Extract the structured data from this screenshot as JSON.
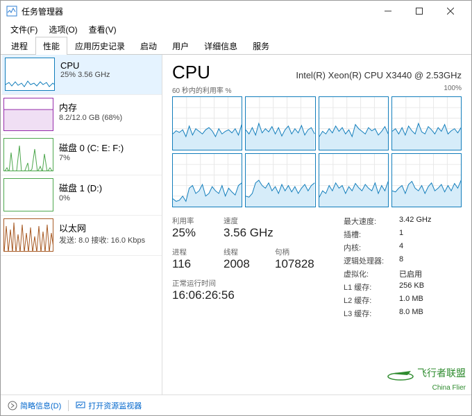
{
  "window": {
    "title": "任务管理器"
  },
  "menu": {
    "file": "文件(F)",
    "options": "选项(O)",
    "view": "查看(V)"
  },
  "tabs": {
    "processes": "进程",
    "performance": "性能",
    "app_history": "应用历史记录",
    "startup": "启动",
    "users": "用户",
    "details": "详细信息",
    "services": "服务"
  },
  "sidebar": {
    "cpu": {
      "title": "CPU",
      "sub": "25% 3.56 GHz"
    },
    "memory": {
      "title": "内存",
      "sub": "8.2/12.0 GB (68%)"
    },
    "disk0": {
      "title": "磁盘 0 (C: E: F:)",
      "sub": "7%"
    },
    "disk1": {
      "title": "磁盘 1 (D:)",
      "sub": "0%"
    },
    "net": {
      "title": "以太网",
      "sub": "发送: 8.0 接收: 16.0 Kbps"
    }
  },
  "main": {
    "title": "CPU",
    "subtitle": "Intel(R) Xeon(R) CPU X3440 @ 2.53GHz",
    "chart_left": "60 秒内的利用率 %",
    "chart_right": "100%"
  },
  "chart_data": {
    "type": "line",
    "description": "8 per-core CPU utilization sparklines over 60s, y-range 0-100%",
    "cores": [
      {
        "core": 0,
        "values": [
          30,
          36,
          33,
          38,
          25,
          45,
          28,
          40,
          35,
          30,
          38,
          42,
          36,
          25,
          40,
          30,
          35,
          38,
          32,
          40,
          28,
          48
        ]
      },
      {
        "core": 1,
        "values": [
          38,
          30,
          42,
          28,
          50,
          32,
          40,
          34,
          44,
          30,
          42,
          26,
          38,
          45,
          30,
          40,
          32,
          46,
          28,
          38,
          42,
          30
        ]
      },
      {
        "core": 2,
        "values": [
          25,
          35,
          30,
          40,
          32,
          45,
          35,
          42,
          30,
          38,
          25,
          48,
          40,
          35,
          30,
          42,
          36,
          40,
          28,
          35,
          44,
          30
        ]
      },
      {
        "core": 3,
        "values": [
          35,
          40,
          30,
          42,
          28,
          45,
          36,
          30,
          50,
          34,
          30,
          44,
          38,
          30,
          42,
          35,
          48,
          30,
          36,
          40,
          32,
          42
        ]
      },
      {
        "core": 4,
        "values": [
          15,
          10,
          12,
          20,
          10,
          35,
          40,
          25,
          30,
          42,
          20,
          25,
          38,
          30,
          25,
          40,
          20,
          35,
          28,
          22,
          40,
          45
        ]
      },
      {
        "core": 5,
        "values": [
          20,
          18,
          25,
          45,
          50,
          40,
          35,
          45,
          30,
          38,
          25,
          42,
          30,
          40,
          28,
          38,
          25,
          35,
          42,
          30,
          40,
          45
        ]
      },
      {
        "core": 6,
        "values": [
          18,
          30,
          25,
          40,
          30,
          45,
          35,
          40,
          25,
          38,
          30,
          44,
          36,
          30,
          42,
          35,
          30,
          45,
          25,
          40,
          30,
          48
        ]
      },
      {
        "core": 7,
        "values": [
          30,
          28,
          35,
          40,
          25,
          42,
          48,
          35,
          30,
          40,
          25,
          38,
          45,
          30,
          35,
          42,
          28,
          40,
          30,
          44,
          35,
          50
        ]
      }
    ],
    "ylim": [
      0,
      100
    ],
    "x_span_seconds": 60
  },
  "stats": {
    "utilization": {
      "label": "利用率",
      "value": "25%"
    },
    "speed": {
      "label": "速度",
      "value": "3.56 GHz"
    },
    "processes": {
      "label": "进程",
      "value": "116"
    },
    "threads": {
      "label": "线程",
      "value": "2008"
    },
    "handles": {
      "label": "句柄",
      "value": "107828"
    },
    "uptime": {
      "label": "正常运行时间",
      "value": "16:06:26:56"
    }
  },
  "specs": {
    "max_speed": {
      "label": "最大速度:",
      "value": "3.42 GHz"
    },
    "sockets": {
      "label": "插槽:",
      "value": "1"
    },
    "cores": {
      "label": "内核:",
      "value": "4"
    },
    "logical": {
      "label": "逻辑处理器:",
      "value": "8"
    },
    "virtualization": {
      "label": "虚拟化:",
      "value": "已启用"
    },
    "l1": {
      "label": "L1 缓存:",
      "value": "256 KB"
    },
    "l2": {
      "label": "L2 缓存:",
      "value": "1.0 MB"
    },
    "l3": {
      "label": "L3 缓存:",
      "value": "8.0 MB"
    }
  },
  "footer": {
    "fewer_details": "简略信息(D)",
    "resource_monitor": "打开资源监视器"
  },
  "watermark": {
    "brand": "飞行者联盟",
    "sub": "China Flier"
  }
}
